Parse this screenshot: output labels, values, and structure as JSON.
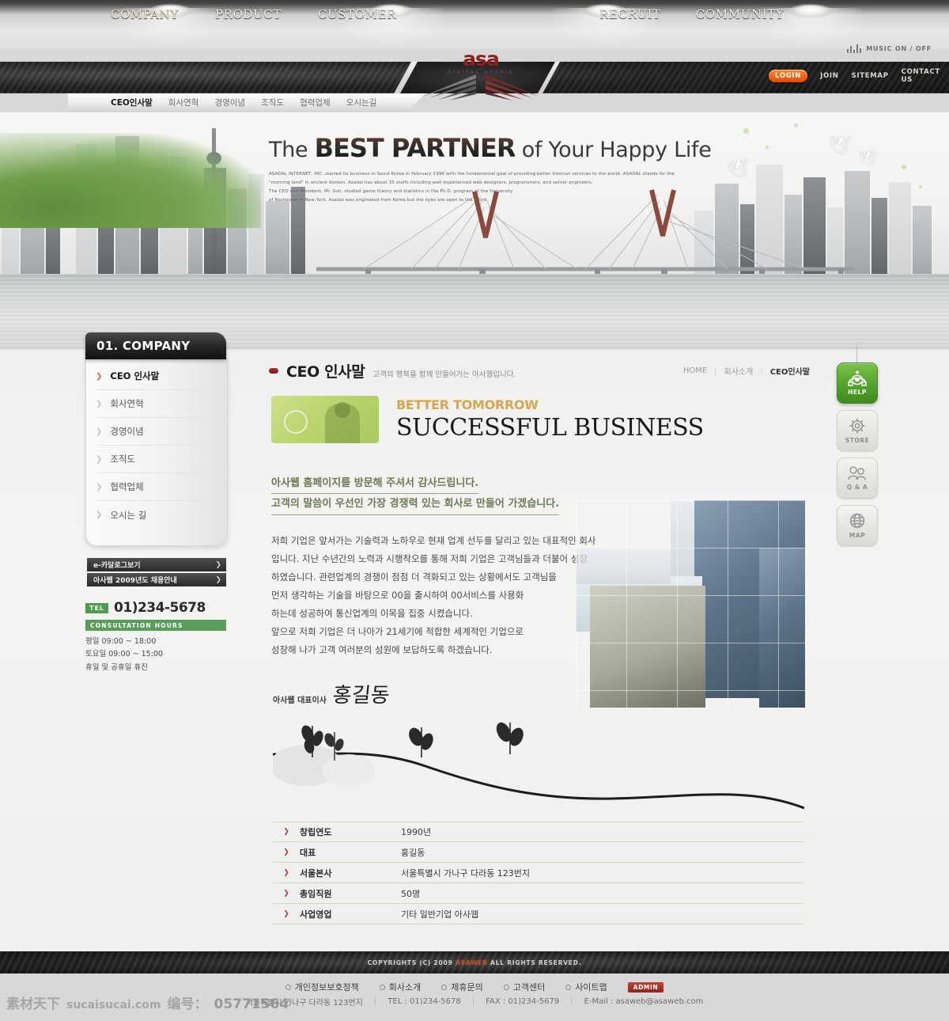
{
  "header": {
    "music_label": "MUSIC ON / OFF",
    "logo": {
      "mark": "asa",
      "sub": "DIGITAL UTOPIA"
    },
    "nav_left": [
      "COMPANY",
      "PRODUCT",
      "CUSTOMER"
    ],
    "nav_right": [
      "RECRUIT",
      "COMMUNITY"
    ],
    "auth": {
      "login": "LOGIN",
      "join": "JOIN",
      "sitemap": "SITEMAP",
      "contact": "CONTACT US"
    },
    "subnav": [
      "CEO인사말",
      "회사연혁",
      "경영이념",
      "조직도",
      "협력업체",
      "오시는길"
    ]
  },
  "hero": {
    "title_pre": "The",
    "title_bold": "BEST PARTNER",
    "title_post": "of Your Happy Life",
    "paragraph_lines": [
      "ASADAL INTERNET, INC. started its business in Seoul Korea in February 1996 with the fundamental goal of providing better Internet services to the world. ASADAL stands for the",
      "\"morning land\" in  ancient Korean. Asadal has about 35 staffs including well experienced web designers, programmers, and server engineers.",
      "The CEO and President, Mr. Suh, studied game theory and statistics in the Ph.D. program at the University",
      "of Rochester  in New York. Asadal was originated from Korea but the eyes are open to the world."
    ]
  },
  "sidebar": {
    "heading": "01. COMPANY",
    "items": [
      {
        "label": "CEO 인사말"
      },
      {
        "label": "회사연혁"
      },
      {
        "label": "경영이념"
      },
      {
        "label": "조직도"
      },
      {
        "label": "협력업체"
      },
      {
        "label": "오시는 길"
      }
    ],
    "buttons": [
      {
        "label": "e-카달로그보기",
        "arrow": "❯"
      },
      {
        "label": "아사웹 2009년도 채용안내",
        "arrow": "❯"
      }
    ],
    "tel_badge": "TEL",
    "tel_number": "01)234-5678",
    "hours_bar": "CONSULTATION HOURS",
    "hours": [
      "평일 09:00 ~ 18:00",
      "토요일 09:00 ~ 15:00",
      "휴일 및 공휴일 휴진"
    ]
  },
  "main": {
    "page_title": "CEO 인사말",
    "page_subtitle": "고객의 행복을 함께 만들어가는 아사웹입니다.",
    "breadcrumb": {
      "home": "HOME",
      "parent": "회사소개",
      "current": "CEO인사말"
    },
    "promo": {
      "kicker": "BETTER TOMORROW",
      "title": "SUCCESSFUL BUSINESS"
    },
    "lead_lines": [
      "아사웹 홈페이지를 방문해 주셔서 감사드립니다.",
      "고객의 말씀이 우선인 가장 경쟁력 있는 회사로 만들어 가겠습니다."
    ],
    "body_lines": [
      "저희 기업은 앞서가는 기술력과 노하우로 현재 업계 선두를 달리고 있는 대표적인 회사",
      "입니다. 지난 수년간의 노력과 시행착오를 통해 저희 기업은 고객님들과 더불어 성장",
      "하였습니다. 관련업계의 경쟁이 점점 더 격화되고 있는 상황에서도 고객님을",
      "먼저 생각하는 기술을 바탕으로 00을 출시하여 00서비스를 사용화",
      "하는데 성공하여 통신업계의 이목을 집중 시켰습니다.",
      "앞으로 저희 기업은 더 나아가 21세기에 적합한 세계적인 기업으로",
      "성장해 나가 고객 여러분의 성원에 보답하도록 하겠습니다."
    ],
    "signature": {
      "role": "아사웹 대표이사",
      "name": "홍길동"
    },
    "info_table": {
      "arrow": "❯",
      "rows": [
        {
          "key": "창립연도",
          "value": "1990년"
        },
        {
          "key": "대표",
          "value": "홍길동"
        },
        {
          "key": "서울본사",
          "value": "서울특별시 가나구 다라동 123번지"
        },
        {
          "key": "총임직원",
          "value": "50명"
        },
        {
          "key": "사업영업",
          "value": "기타 일반기업 아사웹"
        }
      ]
    }
  },
  "quick_links": [
    {
      "label": "HELP",
      "icon": "telephone-icon",
      "active": true
    },
    {
      "label": "STORE",
      "icon": "gear-icon",
      "active": false
    },
    {
      "label": "Q & A",
      "icon": "people-icon",
      "active": false
    },
    {
      "label": "MAP",
      "icon": "globe-icon",
      "active": false
    }
  ],
  "footer": {
    "copyright_pre": "COPYRIGHTS (C) 2009",
    "copyright_brand": "ASAWEB",
    "copyright_post": "ALL RIGHTS RESERVED.",
    "links": [
      "개인정보보호정책",
      "회사소개",
      "제휴문의",
      "고객센터",
      "사이트맵"
    ],
    "admin_badge": "ADMIN",
    "address": "서울특별시 가나구 다라동 123번지",
    "tel": "TEL : 01)234-5678",
    "fax": "FAX : 01)234-5679",
    "email": "E-Mail : asaweb@asaweb.com"
  },
  "watermark": {
    "site_cn": "素材天下",
    "site": "sucaisucai.com",
    "code_label": "编号：",
    "code": "05771564"
  },
  "colors": {
    "accent_orange": "#e04a06",
    "accent_green": "#57a62f",
    "gold": "#d4a84e",
    "dark": "#1a1a1a"
  }
}
